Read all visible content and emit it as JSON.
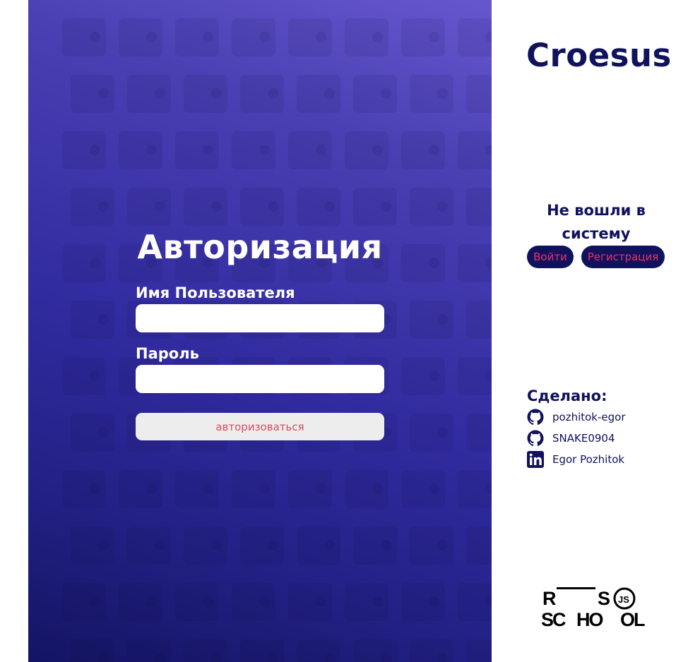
{
  "form": {
    "title": "Авторизация",
    "username_label": "Имя Пользователя",
    "username_value": "",
    "password_label": "Пароль",
    "password_value": "",
    "submit_label": "авторизоваться"
  },
  "sidebar": {
    "logo": "Croesus",
    "status_text": "Не вошли в систему",
    "login_label": "Войти",
    "register_label": "Регистрация",
    "credits_title": "Сделано:",
    "credits": [
      {
        "icon": "github-icon",
        "label": "pozhitok-egor"
      },
      {
        "icon": "github-icon",
        "label": "SNAKE0904"
      },
      {
        "icon": "linkedin-icon",
        "label": "Egor Pozhitok"
      }
    ],
    "school_logo_text": "RS SCHOOL JS"
  },
  "colors": {
    "navy": "#10125c",
    "accent_pink": "#ee2f6a",
    "submit_text": "#e0495d",
    "panel_top": "#6757cf",
    "panel_bottom": "#141463"
  }
}
